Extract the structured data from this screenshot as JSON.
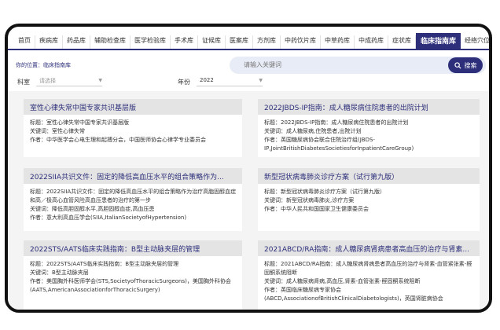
{
  "nav": {
    "items": [
      "首页",
      "疾病库",
      "药品库",
      "辅助检查库",
      "医学检验库",
      "手术库",
      "证候库",
      "医案库",
      "方剂库",
      "中药饮片库",
      "中草药库",
      "中成药库",
      "症状库",
      "临床指南库",
      "经络穴位"
    ],
    "active_index": 13
  },
  "breadcrumb": "你的位置：临床指南库",
  "search": {
    "placeholder": "请输入关键词",
    "button_label": "搜索"
  },
  "filters": {
    "department_label": "科室",
    "department_value": "请选择",
    "year_label": "年份",
    "year_value": "2022"
  },
  "cards": [
    {
      "title": "室性心律失常中国专家共识基层版",
      "lines": [
        "标题：室性心律失常中国专家共识基层版",
        "关键词：室性心律失常",
        "作者：中华医学会心电生理和起搏分会，中国医师协会心律学专业委员会"
      ]
    },
    {
      "title": "2022JBDS-IP指南：成人糖尿病住院患者的出院计划",
      "lines": [
        "标题：2022JBDS-IP指南：成人糖尿病住院患者的出院计划",
        "关键词：成人糖尿病,住院患者,出院计划",
        "作者：英国糖尿病协会联合住院治疗组(JBDS-IP,JointBritishDiabetesSocietiesforInpatientCareGroup)"
      ]
    },
    {
      "title": "2022SIIA共识文件：固定的降低高血压水平的组合策略作为...",
      "lines": [
        "标题：2022SIIA共识文件：固定的降低高血压水平的组合策略作为治疗高脂固醇血症和高／极高心血管风险高血压患者的治疗的第一步",
        "关键词：降低高胆固醇水平,高胆固醇血症,高血压患",
        "作者：意大利高血压学会(SIIA,ItalianSocietyofHypertension)"
      ]
    },
    {
      "title": "新型冠状病毒肺炎诊疗方案（试行第九版）",
      "lines": [
        "标题：新型冠状病毒肺炎诊疗方案（试行第九版）",
        "关键词：新型冠状病毒肺炎,诊疗方案",
        "作者：中华人民共和国国家卫生健康委员会"
      ]
    },
    {
      "title": "2022STS/AATS临床实践指南：B型主动脉夹层的管理",
      "lines": [
        "标题：2022STS/AATS临床实践指南：B型主动脉夹层的管理",
        "关键词：B型主动脉夹层",
        "作者：美国胸外科医师学会(STS,SocietyofThoracicSurgeons)，美国胸外科协会(AATS,AmericanAssociationforThoracicSurgery)"
      ]
    },
    {
      "title": "2021ABCD/RA指南：成人糖尿病肾病患者高血压的治疗与肾素...",
      "lines": [
        "标题：2021ABCD/RA指南：成人糖尿病肾病患者高血压的治疗与肾素-血管紧张素-醛固酮系统阻断",
        "关键词：成人糖尿病肾病,高血压,肾素-血管张素-醛固酮系统阻断",
        "作者：英国临床糖尿病专家协会(ABCD,AssociationofBritishClinicalDiabetologists)，英国肾脏病协会"
      ]
    }
  ]
}
